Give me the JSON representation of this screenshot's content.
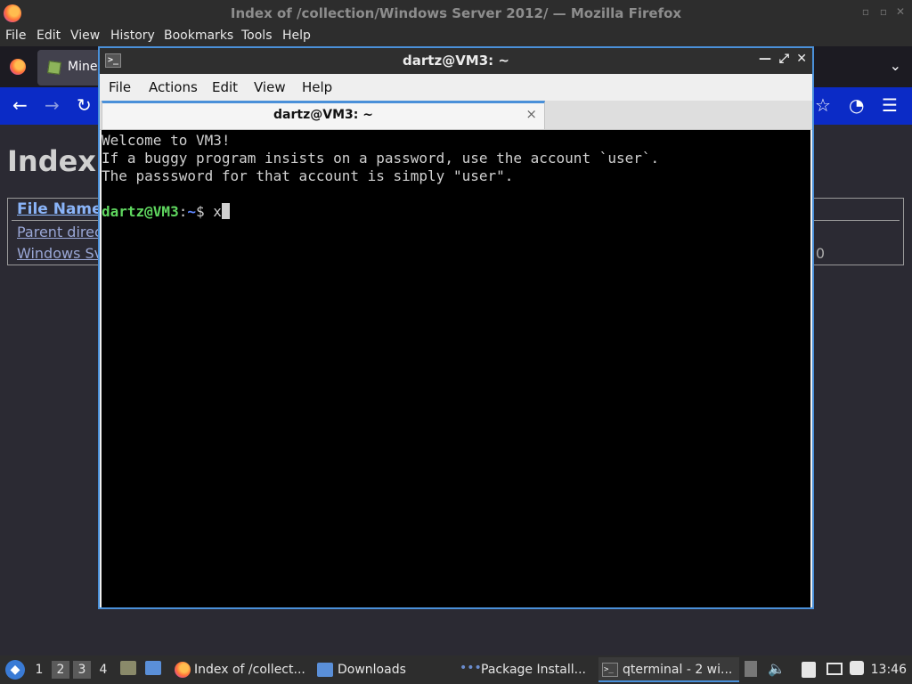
{
  "firefox": {
    "window_title": "Index of /collection/Windows Server 2012/ — Mozilla Firefox",
    "menu": [
      "File",
      "Edit",
      "View",
      "History",
      "Bookmarks",
      "Tools",
      "Help"
    ],
    "tab_title": "Mined",
    "page_heading": "Index",
    "table_header": "File Name",
    "rows": [
      "Parent direc",
      "Windows Sv"
    ],
    "row_size": "0"
  },
  "terminal": {
    "window_title": "dartz@VM3: ~",
    "menu": [
      "File",
      "Actions",
      "Edit",
      "View",
      "Help"
    ],
    "tab_title": "dartz@VM3: ~",
    "tab_close": "×",
    "lines": [
      "Welcome to VM3!",
      "If a buggy program insists on a password, use the account `user`.",
      "The passsword for that account is simply \"user\"."
    ],
    "prompt_user": "dartz@VM3",
    "prompt_sep": ":",
    "prompt_path": "~",
    "prompt_symbol": "$ ",
    "command": "x"
  },
  "taskbar": {
    "workspaces": [
      "1",
      "2",
      "3",
      "4"
    ],
    "tasks": [
      {
        "label": "Index of /collect...",
        "icon": "firefox-icon"
      },
      {
        "label": "Downloads",
        "icon": "folder-icon"
      },
      {
        "label": "Package Install...",
        "icon": "package-installer-icon"
      },
      {
        "label": "qterminal - 2 wi...",
        "icon": "terminal-icon"
      }
    ],
    "clock": "13:46"
  }
}
